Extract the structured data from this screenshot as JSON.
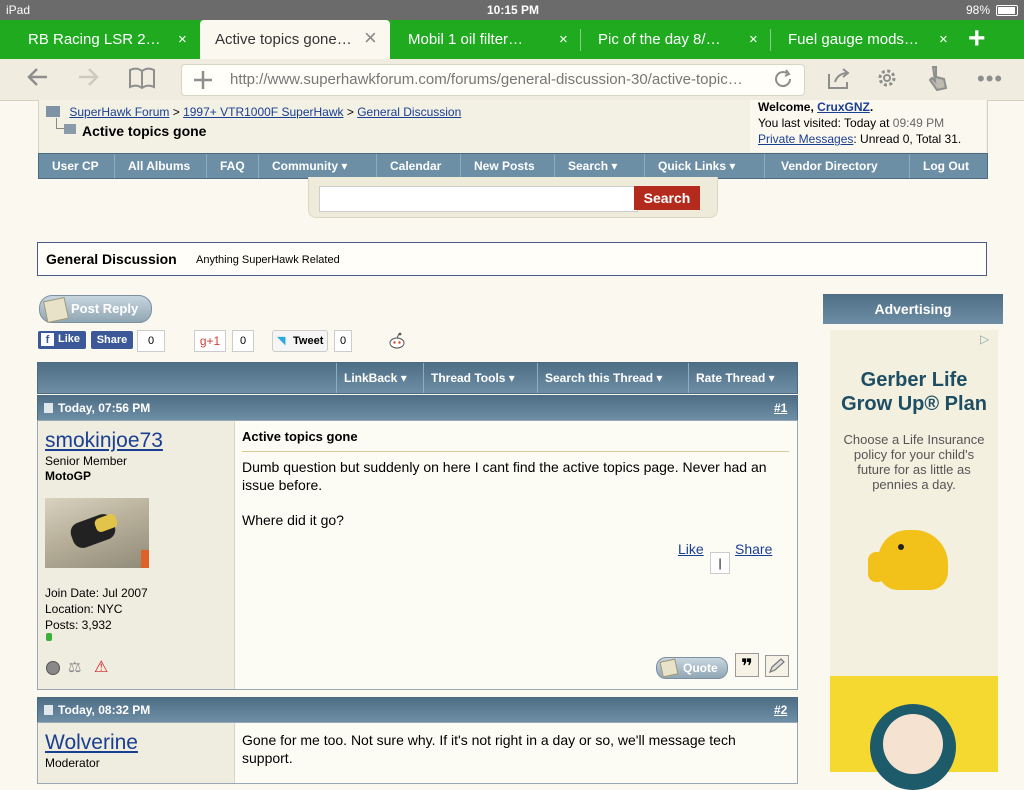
{
  "status": {
    "device": "iPad",
    "time": "10:15 PM",
    "battery": "98%"
  },
  "tabs": [
    {
      "title": "RB Racing LSR 2…",
      "close": "×"
    },
    {
      "title": "Active topics gone…",
      "close": "×"
    },
    {
      "title": "Mobil 1 oil filter…",
      "close": "×"
    },
    {
      "title": "Pic of the day 8/…",
      "close": "×"
    },
    {
      "title": "Fuel gauge mods…",
      "close": "×"
    }
  ],
  "new_tab": "+",
  "toolbar": {
    "url": "http://www.superhawkforum.com/forums/general-discussion-30/active-topic…"
  },
  "breadcrumb": {
    "forum": "SuperHawk Forum",
    "sub": "1997+ VTR1000F SuperHawk",
    "section": "General Discussion",
    "sep": ">",
    "title": "Active topics gone"
  },
  "welcome": {
    "prefix": "Welcome,",
    "user": "CruxGNZ",
    "dot": ".",
    "visited_label": "You last visited: Today at",
    "visited_time": "09:49 PM",
    "pm_link": "Private Messages",
    "pm_text": ": Unread 0, Total 31."
  },
  "nav": [
    "User CP",
    "All Albums",
    "FAQ",
    "Community ▾",
    "Calendar",
    "New Posts",
    "Search ▾",
    "Quick Links ▾",
    "Vendor Directory",
    "Log Out"
  ],
  "search": {
    "button": "Search",
    "placeholder": ""
  },
  "forum_box": {
    "title": "General Discussion",
    "desc": "Anything SuperHawk Related"
  },
  "post_reply": "Post Reply",
  "social": {
    "like": "Like",
    "share": "Share",
    "fb_count": "0",
    "gplus": "g+1",
    "gplus_count": "0",
    "tweet": "Tweet",
    "tweet_count": "0"
  },
  "thread_tools": [
    "LinkBack ▾",
    "Thread Tools ▾",
    "Search this Thread ▾",
    "Rate Thread ▾"
  ],
  "posts": [
    {
      "date": "Today, 07:56 PM",
      "num": "#1",
      "user": "smokinjoe73",
      "rank": "Senior Member",
      "title": "MotoGP",
      "join": "Join Date: Jul 2007",
      "location": "Location: NYC",
      "posts": "Posts: 3,932",
      "subject": "Active topics gone",
      "body1": "Dumb question but suddenly on here I cant find the active topics page. Never had an issue before.",
      "body2": "Where did it go?",
      "like": "Like",
      "share": "Share",
      "quote": "Quote"
    },
    {
      "date": "Today, 08:32 PM",
      "num": "#2",
      "user": "Wolverine",
      "rank": "Moderator",
      "body1": "Gone for me too. Not sure why. If it's not right in a day or so, we'll message tech support."
    }
  ],
  "ad": {
    "header": "Advertising",
    "title1": "Gerber Life",
    "title2": "Grow Up® Plan",
    "text": "Choose a Life Insurance policy for your child's future for as little as pennies a day."
  }
}
